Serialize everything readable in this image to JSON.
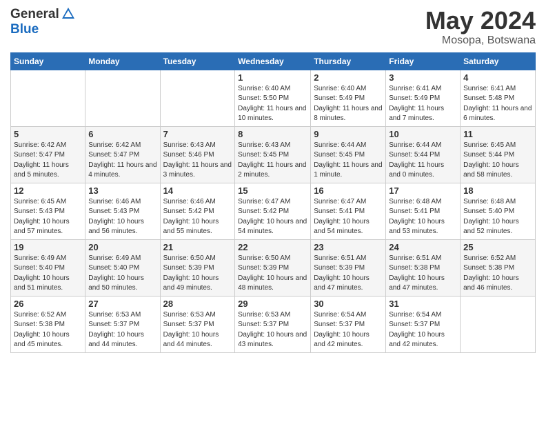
{
  "logo": {
    "general": "General",
    "blue": "Blue"
  },
  "title": "May 2024",
  "location": "Mosopa, Botswana",
  "days_of_week": [
    "Sunday",
    "Monday",
    "Tuesday",
    "Wednesday",
    "Thursday",
    "Friday",
    "Saturday"
  ],
  "weeks": [
    [
      {
        "day": "",
        "sunrise": "",
        "sunset": "",
        "daylight": ""
      },
      {
        "day": "",
        "sunrise": "",
        "sunset": "",
        "daylight": ""
      },
      {
        "day": "",
        "sunrise": "",
        "sunset": "",
        "daylight": ""
      },
      {
        "day": "1",
        "sunrise": "Sunrise: 6:40 AM",
        "sunset": "Sunset: 5:50 PM",
        "daylight": "Daylight: 11 hours and 10 minutes."
      },
      {
        "day": "2",
        "sunrise": "Sunrise: 6:40 AM",
        "sunset": "Sunset: 5:49 PM",
        "daylight": "Daylight: 11 hours and 8 minutes."
      },
      {
        "day": "3",
        "sunrise": "Sunrise: 6:41 AM",
        "sunset": "Sunset: 5:49 PM",
        "daylight": "Daylight: 11 hours and 7 minutes."
      },
      {
        "day": "4",
        "sunrise": "Sunrise: 6:41 AM",
        "sunset": "Sunset: 5:48 PM",
        "daylight": "Daylight: 11 hours and 6 minutes."
      }
    ],
    [
      {
        "day": "5",
        "sunrise": "Sunrise: 6:42 AM",
        "sunset": "Sunset: 5:47 PM",
        "daylight": "Daylight: 11 hours and 5 minutes."
      },
      {
        "day": "6",
        "sunrise": "Sunrise: 6:42 AM",
        "sunset": "Sunset: 5:47 PM",
        "daylight": "Daylight: 11 hours and 4 minutes."
      },
      {
        "day": "7",
        "sunrise": "Sunrise: 6:43 AM",
        "sunset": "Sunset: 5:46 PM",
        "daylight": "Daylight: 11 hours and 3 minutes."
      },
      {
        "day": "8",
        "sunrise": "Sunrise: 6:43 AM",
        "sunset": "Sunset: 5:45 PM",
        "daylight": "Daylight: 11 hours and 2 minutes."
      },
      {
        "day": "9",
        "sunrise": "Sunrise: 6:44 AM",
        "sunset": "Sunset: 5:45 PM",
        "daylight": "Daylight: 11 hours and 1 minute."
      },
      {
        "day": "10",
        "sunrise": "Sunrise: 6:44 AM",
        "sunset": "Sunset: 5:44 PM",
        "daylight": "Daylight: 11 hours and 0 minutes."
      },
      {
        "day": "11",
        "sunrise": "Sunrise: 6:45 AM",
        "sunset": "Sunset: 5:44 PM",
        "daylight": "Daylight: 10 hours and 58 minutes."
      }
    ],
    [
      {
        "day": "12",
        "sunrise": "Sunrise: 6:45 AM",
        "sunset": "Sunset: 5:43 PM",
        "daylight": "Daylight: 10 hours and 57 minutes."
      },
      {
        "day": "13",
        "sunrise": "Sunrise: 6:46 AM",
        "sunset": "Sunset: 5:43 PM",
        "daylight": "Daylight: 10 hours and 56 minutes."
      },
      {
        "day": "14",
        "sunrise": "Sunrise: 6:46 AM",
        "sunset": "Sunset: 5:42 PM",
        "daylight": "Daylight: 10 hours and 55 minutes."
      },
      {
        "day": "15",
        "sunrise": "Sunrise: 6:47 AM",
        "sunset": "Sunset: 5:42 PM",
        "daylight": "Daylight: 10 hours and 54 minutes."
      },
      {
        "day": "16",
        "sunrise": "Sunrise: 6:47 AM",
        "sunset": "Sunset: 5:41 PM",
        "daylight": "Daylight: 10 hours and 54 minutes."
      },
      {
        "day": "17",
        "sunrise": "Sunrise: 6:48 AM",
        "sunset": "Sunset: 5:41 PM",
        "daylight": "Daylight: 10 hours and 53 minutes."
      },
      {
        "day": "18",
        "sunrise": "Sunrise: 6:48 AM",
        "sunset": "Sunset: 5:40 PM",
        "daylight": "Daylight: 10 hours and 52 minutes."
      }
    ],
    [
      {
        "day": "19",
        "sunrise": "Sunrise: 6:49 AM",
        "sunset": "Sunset: 5:40 PM",
        "daylight": "Daylight: 10 hours and 51 minutes."
      },
      {
        "day": "20",
        "sunrise": "Sunrise: 6:49 AM",
        "sunset": "Sunset: 5:40 PM",
        "daylight": "Daylight: 10 hours and 50 minutes."
      },
      {
        "day": "21",
        "sunrise": "Sunrise: 6:50 AM",
        "sunset": "Sunset: 5:39 PM",
        "daylight": "Daylight: 10 hours and 49 minutes."
      },
      {
        "day": "22",
        "sunrise": "Sunrise: 6:50 AM",
        "sunset": "Sunset: 5:39 PM",
        "daylight": "Daylight: 10 hours and 48 minutes."
      },
      {
        "day": "23",
        "sunrise": "Sunrise: 6:51 AM",
        "sunset": "Sunset: 5:39 PM",
        "daylight": "Daylight: 10 hours and 47 minutes."
      },
      {
        "day": "24",
        "sunrise": "Sunrise: 6:51 AM",
        "sunset": "Sunset: 5:38 PM",
        "daylight": "Daylight: 10 hours and 47 minutes."
      },
      {
        "day": "25",
        "sunrise": "Sunrise: 6:52 AM",
        "sunset": "Sunset: 5:38 PM",
        "daylight": "Daylight: 10 hours and 46 minutes."
      }
    ],
    [
      {
        "day": "26",
        "sunrise": "Sunrise: 6:52 AM",
        "sunset": "Sunset: 5:38 PM",
        "daylight": "Daylight: 10 hours and 45 minutes."
      },
      {
        "day": "27",
        "sunrise": "Sunrise: 6:53 AM",
        "sunset": "Sunset: 5:37 PM",
        "daylight": "Daylight: 10 hours and 44 minutes."
      },
      {
        "day": "28",
        "sunrise": "Sunrise: 6:53 AM",
        "sunset": "Sunset: 5:37 PM",
        "daylight": "Daylight: 10 hours and 44 minutes."
      },
      {
        "day": "29",
        "sunrise": "Sunrise: 6:53 AM",
        "sunset": "Sunset: 5:37 PM",
        "daylight": "Daylight: 10 hours and 43 minutes."
      },
      {
        "day": "30",
        "sunrise": "Sunrise: 6:54 AM",
        "sunset": "Sunset: 5:37 PM",
        "daylight": "Daylight: 10 hours and 42 minutes."
      },
      {
        "day": "31",
        "sunrise": "Sunrise: 6:54 AM",
        "sunset": "Sunset: 5:37 PM",
        "daylight": "Daylight: 10 hours and 42 minutes."
      },
      {
        "day": "",
        "sunrise": "",
        "sunset": "",
        "daylight": ""
      }
    ]
  ]
}
